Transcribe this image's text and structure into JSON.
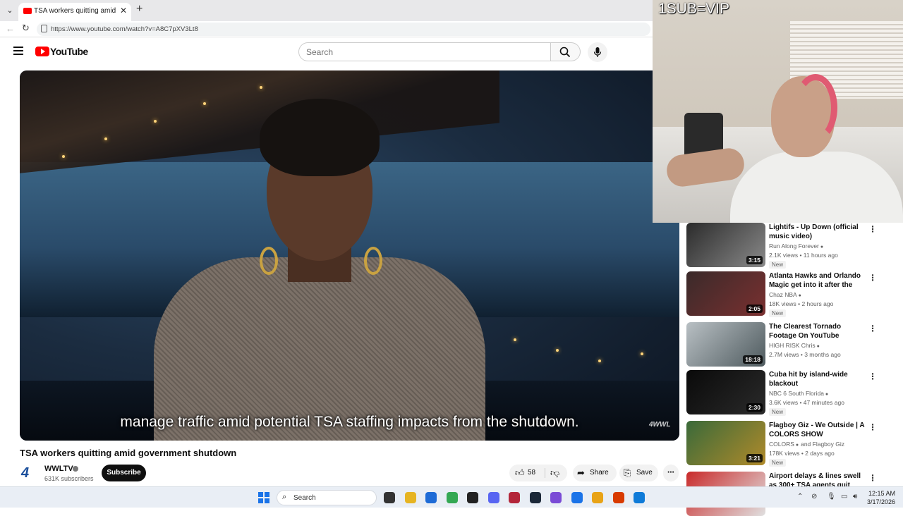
{
  "browser": {
    "tab_title": "TSA workers quitting amid governm",
    "url": "https://www.youtube.com/watch?v=A8C7pXV3Lt8"
  },
  "youtube": {
    "logo_text": "YouTube",
    "search_placeholder": "Search"
  },
  "video": {
    "caption": "manage traffic amid potential TSA staffing impacts from the shutdown.",
    "watermark": "4WWL",
    "title": "TSA workers quitting amid government shutdown",
    "channel_logo": "4",
    "channel_name": "WWLTV",
    "subscribers": "631K subscribers",
    "subscribe_label": "Subscribe",
    "likes": "58",
    "share_label": "Share",
    "save_label": "Save"
  },
  "webcam": {
    "overlay_text": "1SUB=VIP"
  },
  "recommendations": [
    {
      "title": "Lightifs - Up Down (official music video)",
      "channel": "Run Along Forever",
      "verified": true,
      "meta": "2.1K views • 11 hours ago",
      "badge": "New",
      "duration": "3:15",
      "colors": [
        "#2b2b2b",
        "#8a8a8a"
      ]
    },
    {
      "title": "Atlanta Hawks and Orlando Magic get into it after the gam...",
      "channel": "Chaz NBA",
      "verified": true,
      "meta": "18K views • 2 hours ago",
      "badge": "New",
      "duration": "2:05",
      "colors": [
        "#3a2a2a",
        "#7a3030"
      ]
    },
    {
      "title": "The Clearest Tornado Footage On YouTube",
      "channel": "HIGH RISK Chris",
      "verified": true,
      "meta": "2.7M views • 3 months ago",
      "badge": "",
      "duration": "18:18",
      "colors": [
        "#b9c0c4",
        "#4e5a5e"
      ]
    },
    {
      "title": "Cuba hit by island-wide blackout",
      "channel": "NBC 6 South Florida",
      "verified": true,
      "meta": "3.6K views • 47 minutes ago",
      "badge": "New",
      "duration": "2:30",
      "colors": [
        "#0a0a0a",
        "#2a2a2a"
      ]
    },
    {
      "title": "Flagboy Giz - We Outside | A COLORS SHOW",
      "channel": "COLORS",
      "channel_extra": "and Flagboy Giz",
      "verified": true,
      "meta": "178K views • 2 days ago",
      "badge": "New",
      "duration": "3:21",
      "colors": [
        "#3a6a3a",
        "#b08a2a"
      ]
    },
    {
      "title": "Airport delays & lines swell as 300+ TSA agents quit",
      "channel": "",
      "verified": false,
      "meta": "",
      "badge": "",
      "duration": "",
      "colors": [
        "#c92a2a",
        "#e0e0e0"
      ]
    }
  ],
  "taskbar": {
    "search_label": "Search",
    "time": "12:15 AM",
    "date": "3/17/2026",
    "apps": [
      "file-explorer-icon",
      "explorer-icon",
      "store-icon",
      "chrome-icon",
      "github-icon",
      "discord-icon",
      "adobe-icon",
      "steam-icon",
      "obsidian-icon",
      "chrome-dev-icon",
      "chrome-canary-icon",
      "office-icon",
      "edge-icon"
    ],
    "app_colors": [
      "#333333",
      "#e6b422",
      "#1e6bd6",
      "#34a853",
      "#222222",
      "#5865f2",
      "#b3263a",
      "#1b2838",
      "#7a4bd6",
      "#1a73e8",
      "#e8a317",
      "#d83b01",
      "#0f7bd8"
    ]
  },
  "colors": {
    "youtube_red": "#ff0000",
    "subscribe_bg": "#0f0f0f"
  }
}
